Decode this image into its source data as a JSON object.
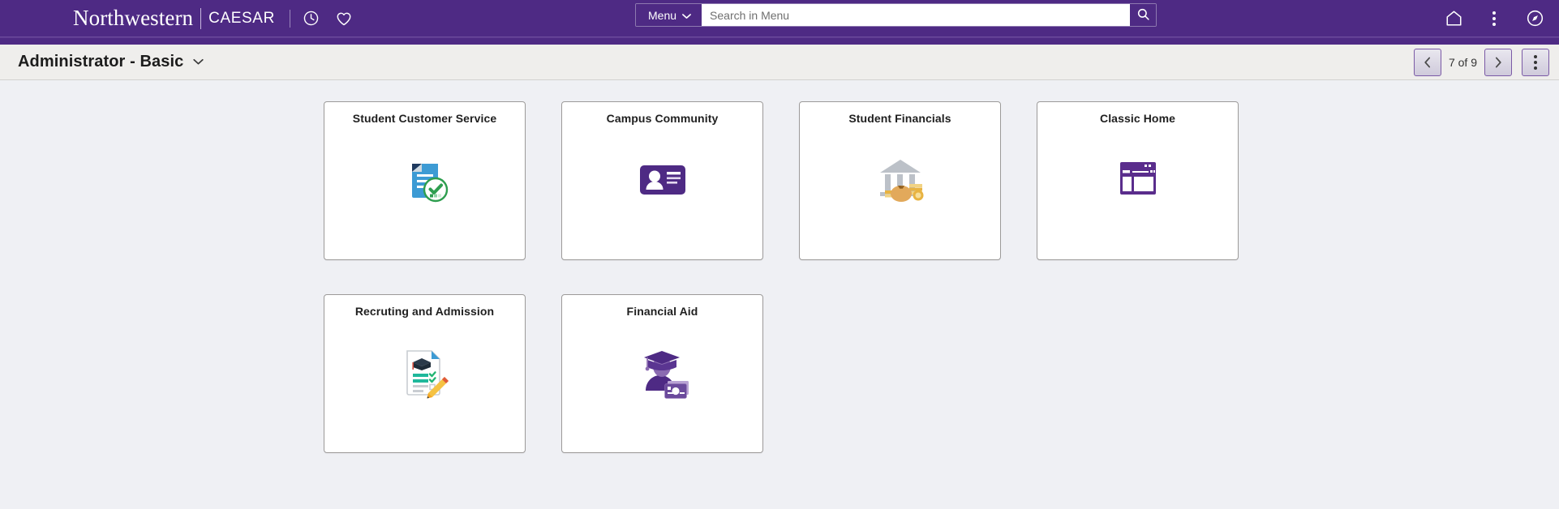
{
  "header": {
    "brand_main": "Northwestern",
    "brand_sub": "CAESAR",
    "clock_icon": "clock-icon",
    "heart_icon": "heart-icon",
    "home_icon": "home-icon",
    "actions_icon": "three-dots-vertical-icon",
    "nav_icon": "compass-icon",
    "purple": "#4E2A84"
  },
  "search": {
    "menu_label": "Menu",
    "placeholder": "Search in Menu",
    "value": "",
    "search_icon": "search-icon",
    "chevron_icon": "chevron-down-icon"
  },
  "subheader": {
    "title": "Administrator - Basic",
    "title_chevron": "chevron-down-icon",
    "prev_label": "‹",
    "next_label": "›",
    "page_count": "7 of 9",
    "more_icon": "three-dots-vertical-icon"
  },
  "tiles": [
    {
      "label": "Student Customer Service",
      "icon": "document-check-icon"
    },
    {
      "label": "Campus Community",
      "icon": "id-card-icon"
    },
    {
      "label": "Student Financials",
      "icon": "bank-money-icon"
    },
    {
      "label": "Classic Home",
      "icon": "browser-window-icon"
    },
    {
      "label": "Recruting and Admission",
      "icon": "application-pencil-icon"
    },
    {
      "label": "Financial Aid",
      "icon": "graduate-money-icon"
    }
  ],
  "colors": {
    "nu_purple": "#4E2A84",
    "content_bg": "#EFF0F4",
    "subbar_bg": "#EFEEEC",
    "tile_border": "#9C9A99",
    "doc_blue": "#3D9BD4",
    "check_green": "#2E9E4F",
    "coin_gold": "#E8B341",
    "bank_gray": "#BCC1C8",
    "teal": "#1FB89B",
    "pencil_yellow": "#F5C243"
  }
}
